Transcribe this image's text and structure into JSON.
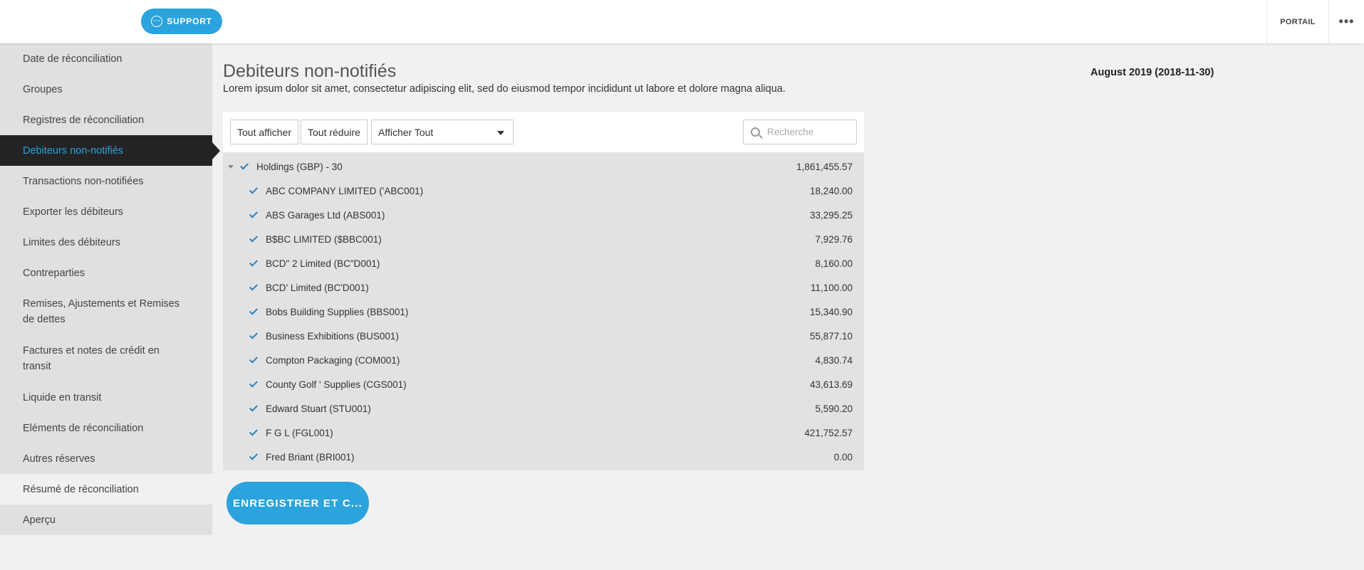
{
  "header": {
    "support_label": "SUPPORT",
    "portail_label": "PORTAIL",
    "more_label": "•••"
  },
  "sidebar": {
    "items": [
      {
        "label": "Date de réconciliation"
      },
      {
        "label": "Groupes"
      },
      {
        "label": "Registres de réconciliation"
      },
      {
        "label": "Debiteurs non-notifiés",
        "active": true
      },
      {
        "label": "Transactions non-notifiées"
      },
      {
        "label": "Exporter les débiteurs"
      },
      {
        "label": "Limites des débiteurs"
      },
      {
        "label": "Contreparties"
      },
      {
        "label": "Remises, Ajustements et Remises de dettes"
      },
      {
        "label": "Factures et notes de crédit en transit"
      },
      {
        "label": "Liquide en transit"
      },
      {
        "label": "Eléments de réconciliation"
      },
      {
        "label": "Autres réserves"
      },
      {
        "label": "Résumé de réconciliation"
      },
      {
        "label": "Aperçu"
      }
    ]
  },
  "main": {
    "title": "Debiteurs non-notifiés",
    "description": "Lorem ipsum dolor sit amet, consectetur adipiscing elit, sed do eiusmod tempor incididunt ut labore et dolore magna aliqua.",
    "period": "August 2019 (2018-11-30)",
    "toolbar": {
      "show_all": "Tout afficher",
      "collapse_all": "Tout réduire",
      "filter_value": "Afficher Tout",
      "search_placeholder": "Recherche"
    },
    "group": {
      "label": "Holdings (GBP) - 30",
      "amount": "1,861,455.57"
    },
    "rows": [
      {
        "label": "ABC COMPANY LIMITED ('ABC001)",
        "amount": "18,240.00"
      },
      {
        "label": "ABS Garages Ltd (ABS001)",
        "amount": "33,295.25"
      },
      {
        "label": "B$BC LIMITED ($BBC001)",
        "amount": "7,929.76"
      },
      {
        "label": "BCD\" 2 Limited (BC\"D001)",
        "amount": "8,160.00"
      },
      {
        "label": "BCD' Limited (BC'D001)",
        "amount": "11,100.00"
      },
      {
        "label": "Bobs Building Supplies (BBS001)",
        "amount": "15,340.90"
      },
      {
        "label": "Business Exhibitions (BUS001)",
        "amount": "55,877.10"
      },
      {
        "label": "Compton Packaging (COM001)",
        "amount": "4,830.74"
      },
      {
        "label": "County Golf ' Supplies (CGS001)",
        "amount": "43,613.69"
      },
      {
        "label": "Edward Stuart (STU001)",
        "amount": "5,590.20"
      },
      {
        "label": "F G L (FGL001)",
        "amount": "421,752.57"
      },
      {
        "label": "Fred Briant (BRI001)",
        "amount": "0.00"
      }
    ],
    "save_label": "ENREGISTRER ET C..."
  }
}
